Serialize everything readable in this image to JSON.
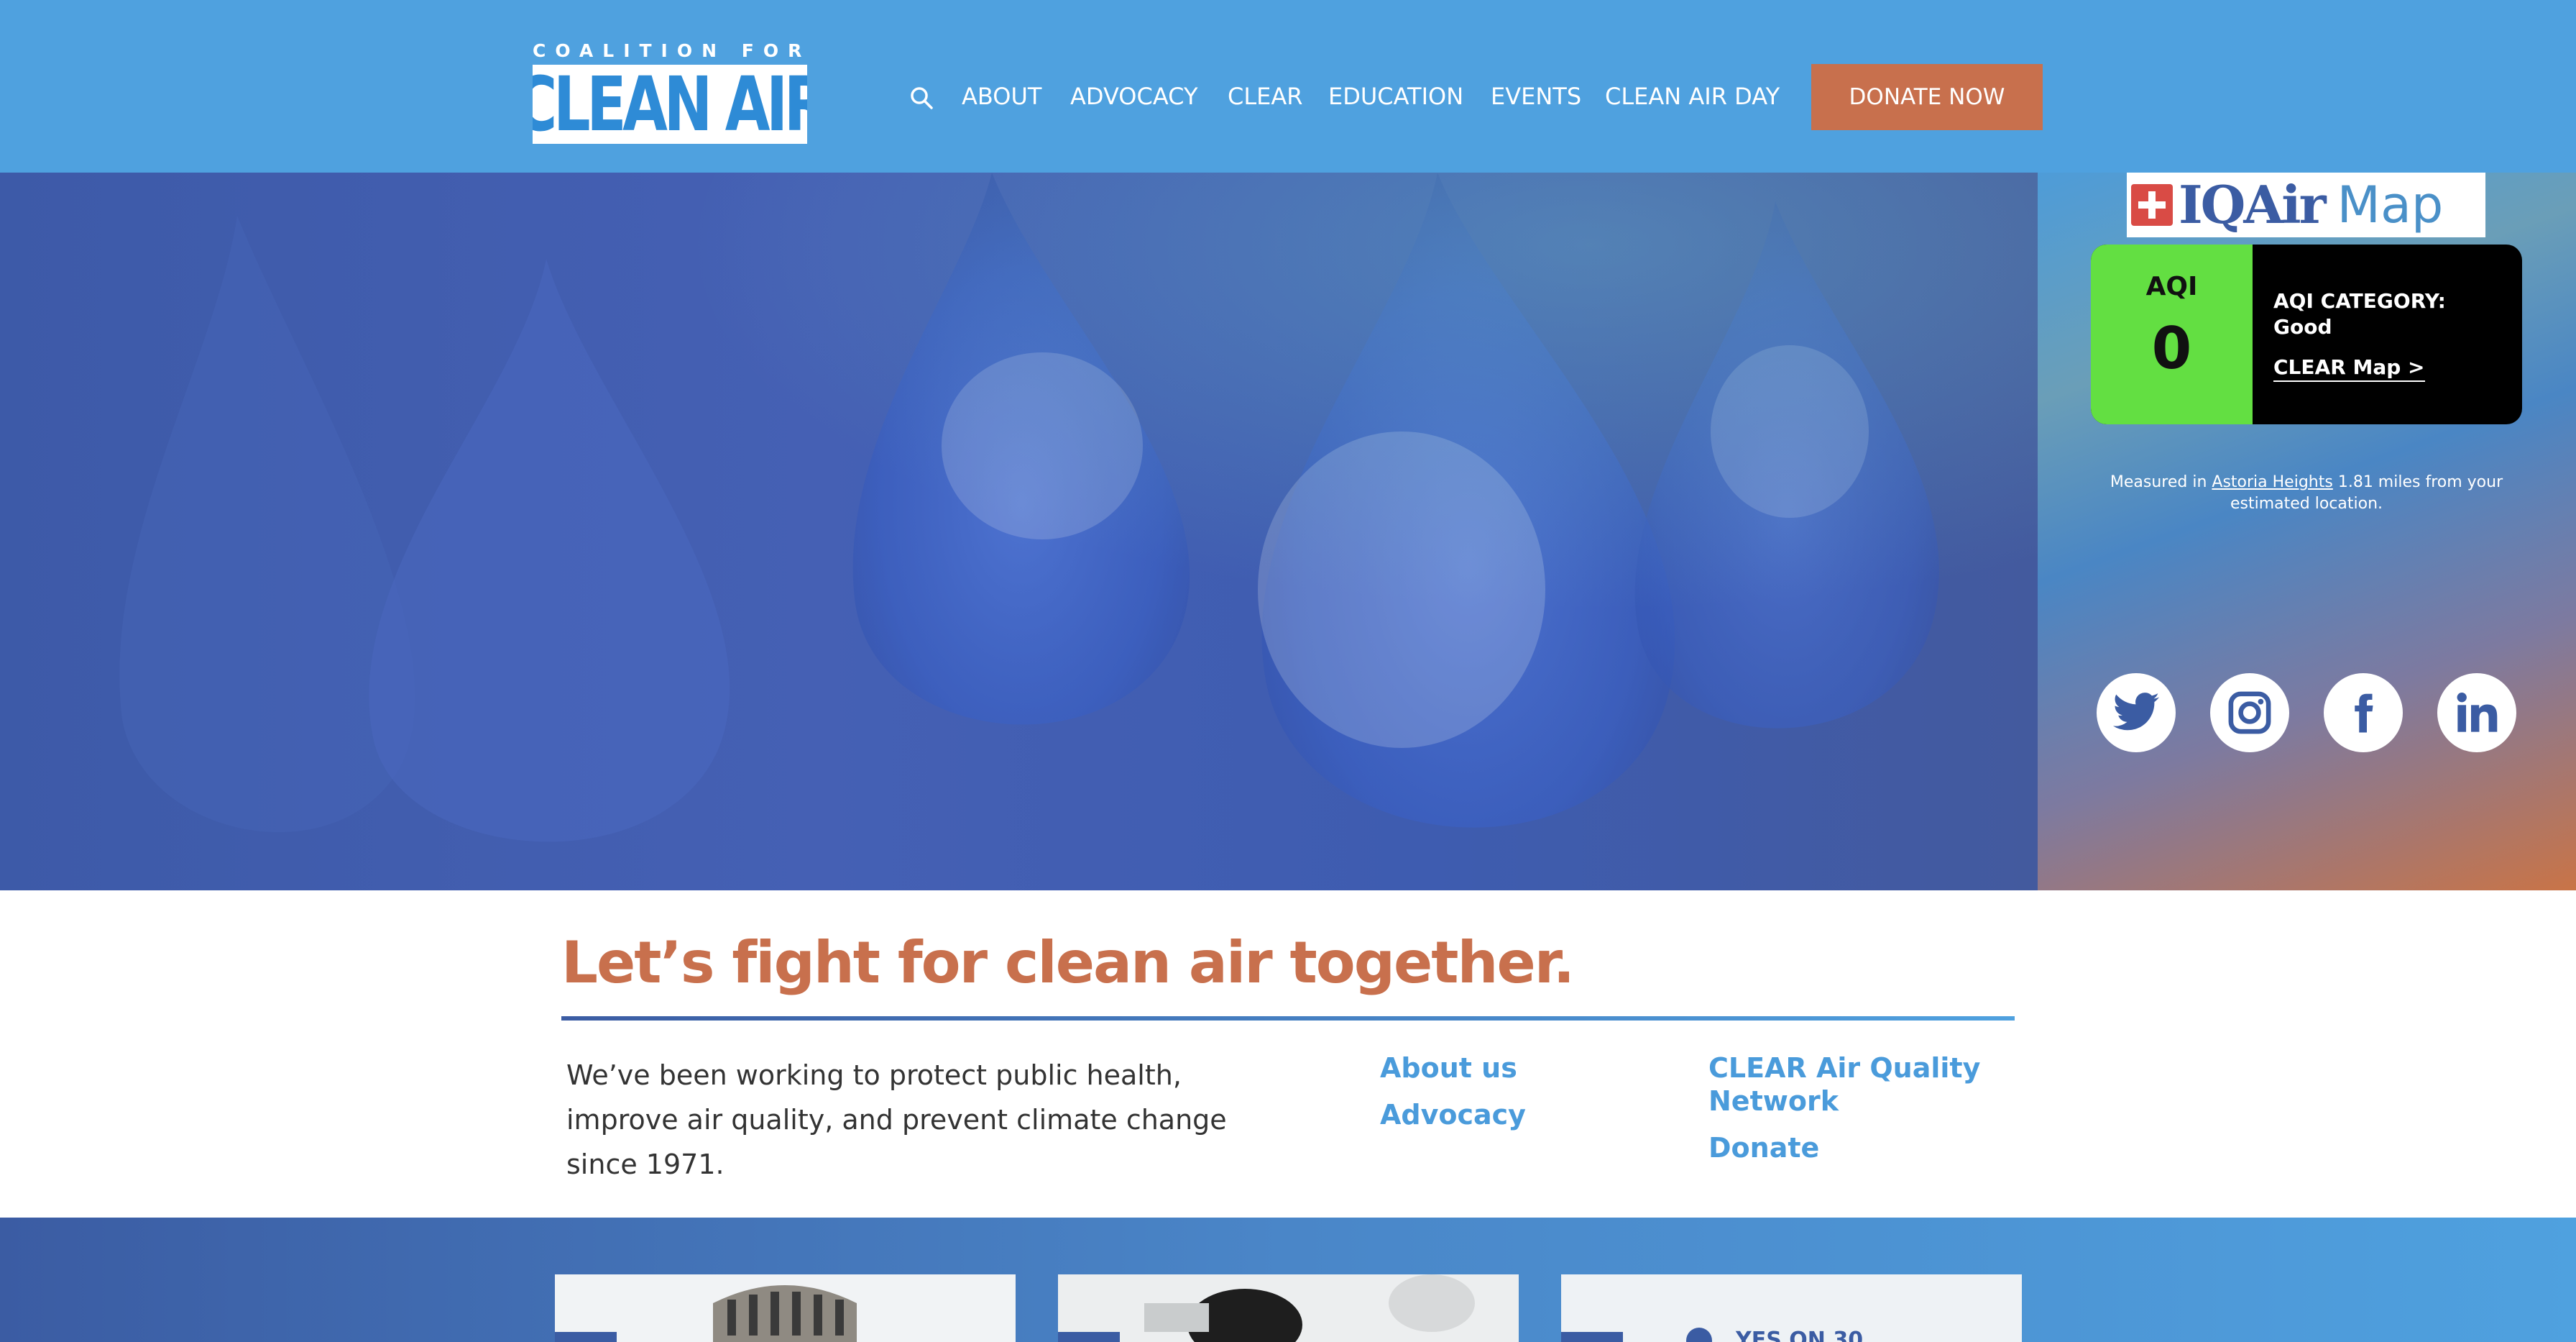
{
  "header": {
    "logo_top": "COALITION FOR",
    "logo_main": "CLEAN AIR",
    "nav": [
      "ABOUT",
      "ADVOCACY",
      "CLEAR",
      "EDUCATION",
      "EVENTS",
      "CLEAN AIR DAY"
    ],
    "search_icon": "search-icon",
    "donate_label": "DONATE NOW",
    "colors": {
      "header_bg": "#4fa1df",
      "donate_bg": "#c8704d"
    }
  },
  "hero": {
    "overlay_color": "#3f5bb0"
  },
  "widget": {
    "brand": "IQAir",
    "brand_suffix": "Map",
    "aqi_label": "AQI",
    "aqi_value": "0",
    "category_label": "AQI CATEGORY:",
    "category_value": "Good",
    "map_link": "CLEAR Map >",
    "measured_prefix": "Measured in",
    "measured_place": "Astoria Heights",
    "measured_suffix": "1.81 miles from your estimated location.",
    "colors": {
      "aqi_good": "#63df42"
    }
  },
  "social": [
    "twitter-icon",
    "instagram-icon",
    "facebook-icon",
    "linkedin-icon"
  ],
  "content": {
    "headline": "Let’s fight for clean air together.",
    "intro": "We’ve been working to protect public health, improve air quality, and prevent climate change since 1971.",
    "links_col1": [
      "About us",
      "Advocacy"
    ],
    "links_col2": [
      "CLEAR Air Quality Network",
      "Donate"
    ]
  },
  "cards": {
    "card3_text": "YES ON 30"
  }
}
